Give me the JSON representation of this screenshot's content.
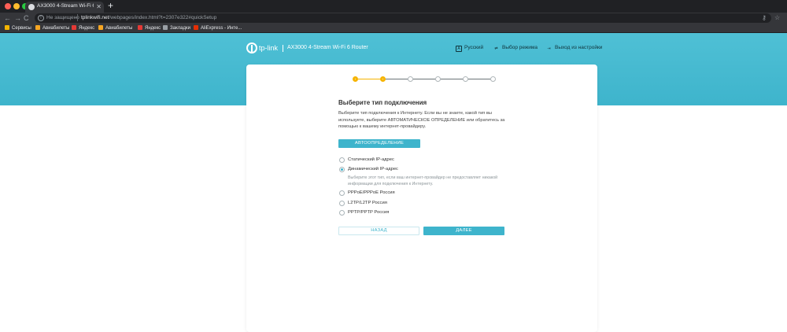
{
  "browser": {
    "tab_title": "AX3000 4-Stream Wi-Fi 6 Rou",
    "tab_close": "✕",
    "new_tab": "+",
    "nav": {
      "back": "←",
      "forward": "→",
      "reload": "C"
    },
    "security_label": "Не защищено",
    "url_host": "tplinkwifi.net",
    "url_path": "/webpages/index.html?t=2307e322#quickSetup",
    "bookmarks": [
      {
        "label": "Сервисы",
        "icon": "apps-grid-icon",
        "color": "#f4b400"
      },
      {
        "label": "Авиабилеты",
        "icon": "plane-icon",
        "color": "#f6a623"
      },
      {
        "label": "Яндекс",
        "icon": "yandex-icon",
        "color": "#e53935"
      },
      {
        "label": "Авиабилеты",
        "icon": "plane-icon",
        "color": "#f6a623"
      },
      {
        "label": "Яндекс",
        "icon": "yandex-icon",
        "color": "#e53935"
      },
      {
        "label": "Закладки",
        "icon": "folder-icon",
        "color": "#9aa0a6"
      },
      {
        "label": "AliExpress - Инте...",
        "icon": "aliexpress-icon",
        "color": "#e62e04"
      }
    ]
  },
  "header": {
    "brand": "tp-link",
    "router_name": "AX3000 4-Stream Wi-Fi 6 Router",
    "language": "Русский",
    "mode": "Выбор режима",
    "logout": "Выход из настройки"
  },
  "stepper": {
    "total": 6,
    "completed": 2,
    "active_color": "#f6b400",
    "inactive_color": "#b0b7ba"
  },
  "content": {
    "title": "Выберите тип подключения",
    "description": "Выберите тип подключения к Интернету. Если вы не знаете, какой тип вы используете, выберите АВТОМАТИЧЕСКОЕ ОПРЕДЕЛЕНИЕ или обратитесь за помощью к вашему интернет-провайдеру.",
    "auto_detect_label": "АВТООПРЕДЕЛЕНИЕ",
    "options": [
      {
        "label": "Статический IP-адрес",
        "checked": false
      },
      {
        "label": "Динамический IP-адрес",
        "checked": true
      },
      {
        "label": "PPPoE/PPPoE Россия",
        "checked": false
      },
      {
        "label": "L2TP/L2TP Россия",
        "checked": false
      },
      {
        "label": "PPTP/PPTP Россия",
        "checked": false
      }
    ],
    "dynamic_hint": "Выберите этот тип, если ваш интернет-провайдер не предоставляет никакой информации для подключения к Интернету.",
    "back_label": "НАЗАД",
    "next_label": "ДАЛЕЕ"
  },
  "colors": {
    "accent": "#3eb4cc",
    "header": "#4fc0d5",
    "step_done": "#f6b400"
  }
}
